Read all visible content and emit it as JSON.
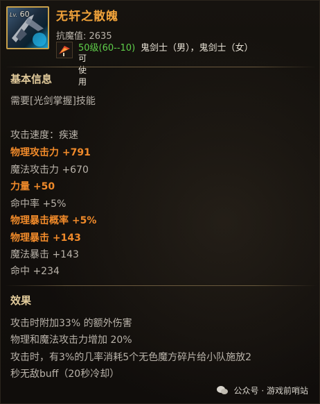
{
  "item": {
    "level_prefix": "Lv.",
    "level": "60",
    "name": "无轩之散魄",
    "resist": "抗魔值: 2635",
    "level_range": "50级(60--10)",
    "classes": "鬼剑士（男），鬼剑士（女）",
    "usable": "可使用",
    "icon": "sword-art-icon",
    "weapon_icon": "fan-weapon-icon"
  },
  "basic": {
    "title": "基本信息",
    "requirement": "需要[光剑掌握]技能",
    "stats": [
      {
        "text": "攻击速度：疾速",
        "highlight": false
      },
      {
        "text": "物理攻击力 +791",
        "highlight": true
      },
      {
        "text": "魔法攻击力 +670",
        "highlight": false
      },
      {
        "text": "力量 +50",
        "highlight": true
      },
      {
        "text": "命中率 +5%",
        "highlight": false
      },
      {
        "text": "物理暴击概率 +5%",
        "highlight": true
      },
      {
        "text": "物理暴击 +143",
        "highlight": true
      },
      {
        "text": "魔法暴击 +143",
        "highlight": false
      },
      {
        "text": "命中 +234",
        "highlight": false
      }
    ]
  },
  "effects": {
    "title": "效果",
    "lines": [
      "攻击时附加33% 的额外伤害",
      "物理和魔法攻击力增加 20%",
      "攻击时，有3%的几率消耗5个无色魔方碎片给小队施放2",
      "秒无敌buff（20秒冷却）"
    ]
  },
  "footer": {
    "source": "公众号 · 游戏前哨站",
    "icon": "wechat-icon"
  },
  "colors": {
    "name": "#f0a23a",
    "highlight": "#f08a2a",
    "level_range": "#5fcf4a",
    "section_title": "#e3cc9c"
  }
}
